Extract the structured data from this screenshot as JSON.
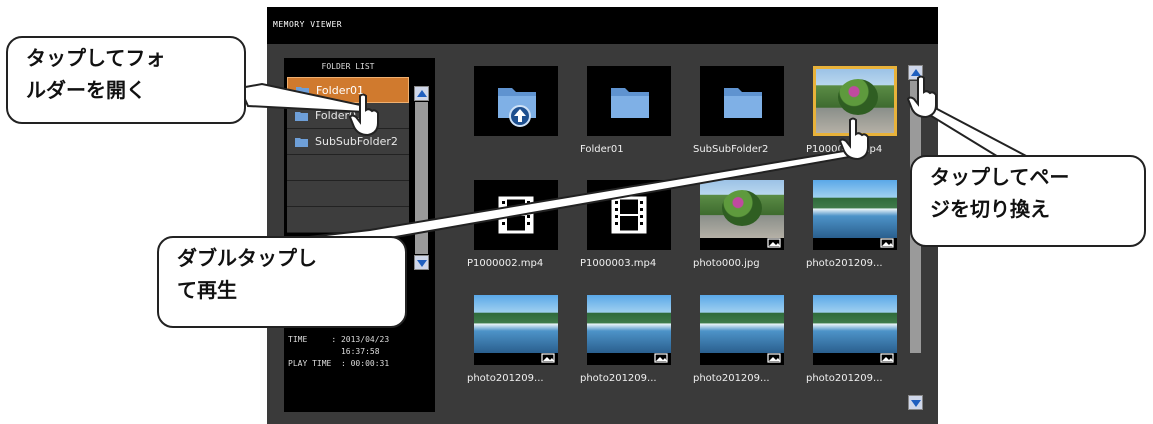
{
  "window": {
    "title": "MEMORY VIEWER"
  },
  "folder_panel": {
    "label": "FOLDER LIST",
    "folders": [
      "Folder01",
      "Folder01",
      "SubSubFolder2",
      "",
      "",
      ""
    ],
    "selected_index": 0
  },
  "info": {
    "time_line": "TIME     : 2013/04/23",
    "time_line2": "           16:37:58",
    "play_time_line": "PLAY TIME  : 00:00:31"
  },
  "grid": {
    "items": [
      {
        "label": "",
        "kind": "parent-folder"
      },
      {
        "label": "Folder01",
        "kind": "folder"
      },
      {
        "label": "SubSubFolder2",
        "kind": "folder"
      },
      {
        "label": "P1000001.mp4",
        "kind": "flower",
        "selected": true
      },
      {
        "label": "P1000002.mp4",
        "kind": "video"
      },
      {
        "label": "P1000003.mp4",
        "kind": "video"
      },
      {
        "label": "photo000.jpg",
        "kind": "flower-photo"
      },
      {
        "label": "photo201209...",
        "kind": "lake-photo"
      },
      {
        "label": "photo201209...",
        "kind": "lake-photo"
      },
      {
        "label": "photo201209...",
        "kind": "lake-photo"
      },
      {
        "label": "photo201209...",
        "kind": "lake-photo"
      },
      {
        "label": "photo201209...",
        "kind": "lake-photo"
      }
    ]
  },
  "callouts": {
    "open_folder": "タップしてフォルダーを開く",
    "open_folder_line1": "タップしてフォ",
    "open_folder_line2": "ルダーを開く",
    "page_switch_line1": "タップしてペー",
    "page_switch_line2": "ジを切り換え",
    "double_tap_line1": "ダブルタップし",
    "double_tap_line2": "て再生"
  },
  "colors": {
    "selected_folder": "#d07a2e",
    "selected_tile_border": "#e8b23a",
    "scroll_arrow": "#1f5fbf"
  }
}
